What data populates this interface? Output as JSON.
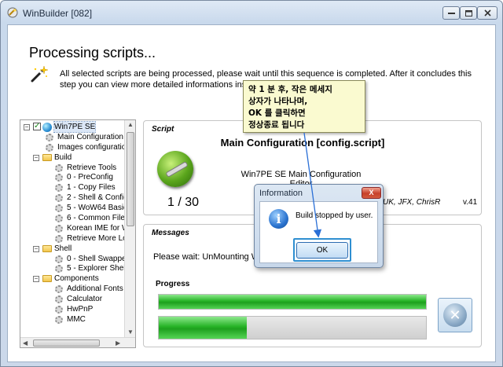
{
  "window": {
    "title": "WinBuilder [082]"
  },
  "header": {
    "title": "Processing scripts...",
    "description": "All selected scripts are being processed, please wait until this sequence is completed. After it concludes this step you can view more detailed informations inside the log ta"
  },
  "tree": {
    "items": [
      {
        "label": "Win7PE SE",
        "level": 0,
        "icon": "globe-icon",
        "expander": "minus",
        "checked": true,
        "selected": true
      },
      {
        "label": "Main Configuration",
        "level": 1,
        "icon": "gear-icon"
      },
      {
        "label": "Images configuration",
        "level": 1,
        "icon": "gear-icon"
      },
      {
        "label": "Build",
        "level": 1,
        "icon": "folder-icon",
        "expander": "minus"
      },
      {
        "label": "Retrieve Tools",
        "level": 2,
        "icon": "gear-icon"
      },
      {
        "label": "0 - PreConfig",
        "level": 2,
        "icon": "gear-icon"
      },
      {
        "label": "1 - Copy Files",
        "level": 2,
        "icon": "gear-icon"
      },
      {
        "label": "2 - Shell & Config",
        "level": 2,
        "icon": "gear-icon"
      },
      {
        "label": "5 - WoW64 Basic",
        "level": 2,
        "icon": "gear-icon"
      },
      {
        "label": "6 - Common Files",
        "level": 2,
        "icon": "gear-icon"
      },
      {
        "label": "Korean IME for W",
        "level": 2,
        "icon": "gear-icon"
      },
      {
        "label": "Retrieve More Lo",
        "level": 2,
        "icon": "gear-icon"
      },
      {
        "label": "Shell",
        "level": 1,
        "icon": "folder-icon",
        "expander": "minus"
      },
      {
        "label": "0 - Shell Swapper",
        "level": 2,
        "icon": "gear-icon"
      },
      {
        "label": "5 - Explorer Shell",
        "level": 2,
        "icon": "gear-icon"
      },
      {
        "label": "Components",
        "level": 1,
        "icon": "folder-icon",
        "expander": "minus"
      },
      {
        "label": "Additional Fonts a",
        "level": 2,
        "icon": "gear-icon"
      },
      {
        "label": "Calculator",
        "level": 2,
        "icon": "gear-icon"
      },
      {
        "label": "HwPnP",
        "level": 2,
        "icon": "gear-icon"
      },
      {
        "label": "MMC",
        "level": 2,
        "icon": "gear-icon"
      }
    ]
  },
  "script": {
    "section_label": "Script",
    "name": "Main Configuration [config.script]",
    "description": "Win7PE SE Main Configuration Editor",
    "counter": "1 / 30",
    "author": "UK, JFX, ChrisR",
    "version": "v.41"
  },
  "messages": {
    "section_label": "Messages",
    "text": "Please wait: UnMounting WI",
    "progress_label": "Progress",
    "progress_overall": 1.0,
    "progress_current": 0.33
  },
  "dialog": {
    "title": "Information",
    "close_label": "X",
    "message": "Build stopped by user.",
    "icon": "info-icon",
    "ok_label": "OK"
  },
  "callout": {
    "text": "약 1 분 후, 작은 메세지\n상자가 나타나며,\nOK 를 클릭하면\n정상종료 됩니다"
  },
  "colors": {
    "progress_green": "#26b326",
    "callout_bg": "#fafad0",
    "arrow_blue": "#2a6fd6"
  }
}
